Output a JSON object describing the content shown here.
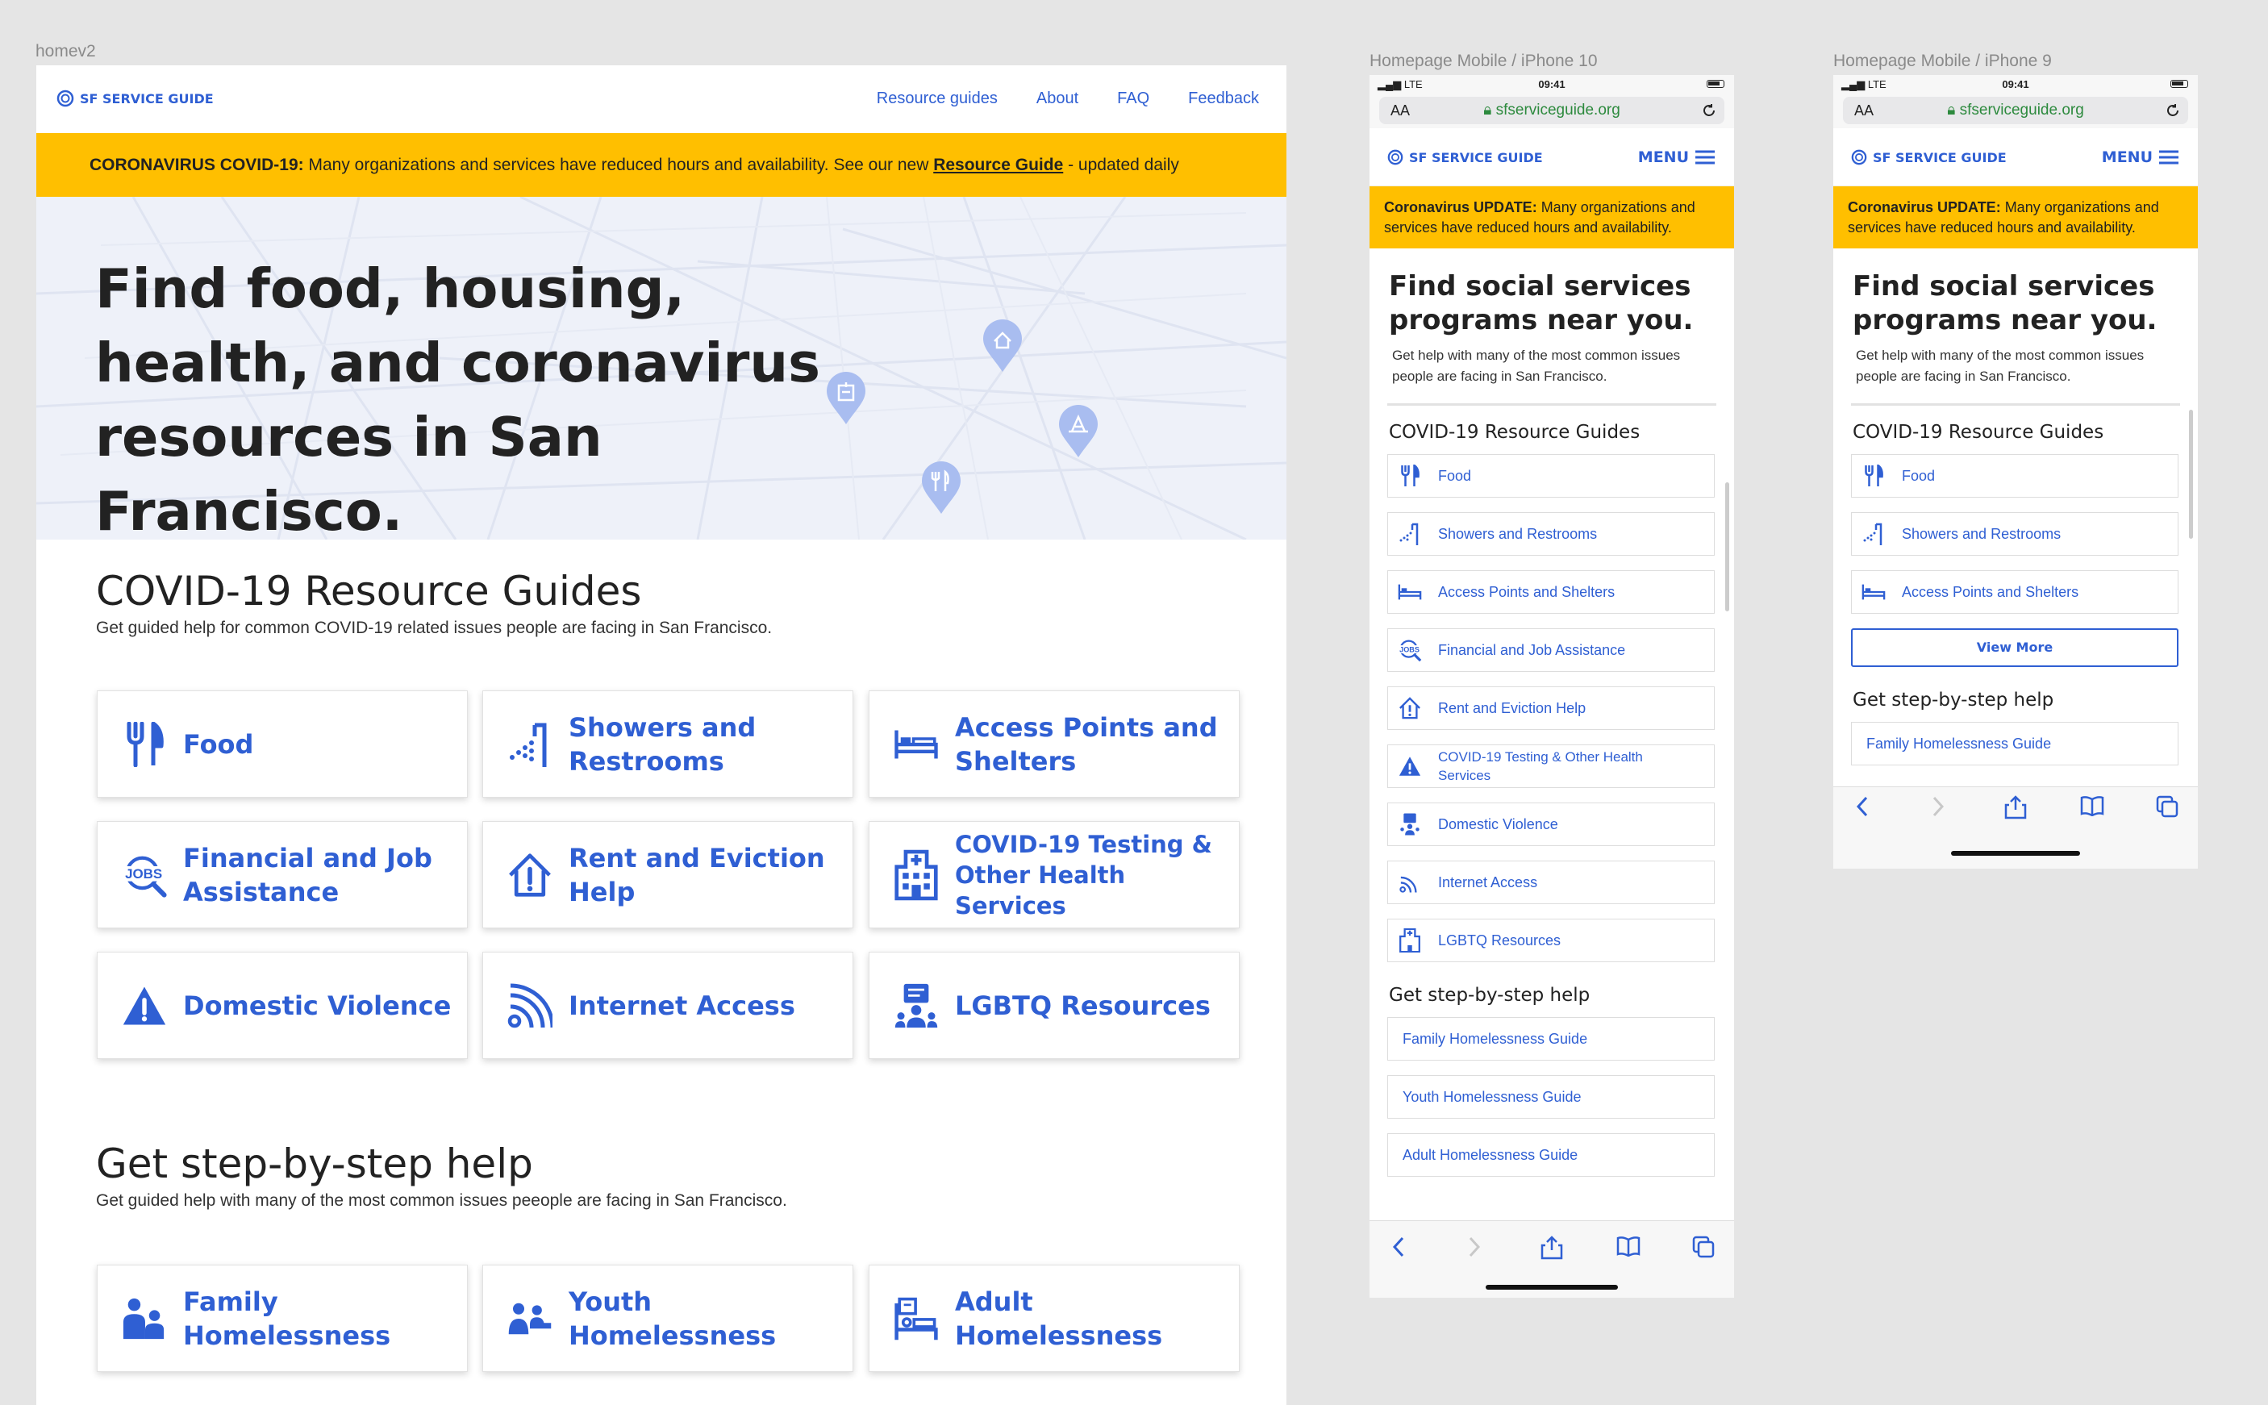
{
  "frames": {
    "desktop_label": "homev2",
    "mobile_label_1": "Homepage Mobile / iPhone 10",
    "mobile_label_2": "Homepage Mobile / iPhone 9"
  },
  "brand": {
    "logo_text": "SF SERVICE GUIDE",
    "accent": "#2f5fd3",
    "banner_color": "#ffbf00"
  },
  "desktop": {
    "nav": [
      "Resource guides",
      "About",
      "FAQ",
      "Feedback"
    ],
    "banner": {
      "prefix": "CORONAVIRUS COVID-19:",
      "text": " Many organizations and services have reduced hours and availability. See our new ",
      "link": "Resource Guide",
      "suffix": " - updated daily"
    },
    "hero_title": "Find food, housing, health, and coronavirus resources in San Francisco.",
    "covid_section": {
      "title": "COVID-19 Resource Guides",
      "subtitle": "Get guided help for common COVID-19 related issues people are facing in San Francisco.",
      "cards": [
        {
          "label": "Food",
          "icon": "utensils-icon"
        },
        {
          "label": "Showers and Restrooms",
          "icon": "shower-icon"
        },
        {
          "label": "Access Points and Shelters",
          "icon": "bed-icon"
        },
        {
          "label": "Financial and Job Assistance",
          "icon": "jobs-search-icon"
        },
        {
          "label": "Rent and Eviction Help",
          "icon": "house-alert-icon"
        },
        {
          "label": "COVID-19 Testing & Other Health Services",
          "icon": "hospital-icon"
        },
        {
          "label": "Domestic Violence",
          "icon": "warning-icon"
        },
        {
          "label": "Internet Access",
          "icon": "wifi-icon"
        },
        {
          "label": "LGBTQ Resources",
          "icon": "community-icon"
        }
      ]
    },
    "steps_section": {
      "title": "Get step-by-step help",
      "subtitle": "Get guided help with many of the most common issues peeople are facing in San Francisco.",
      "cards": [
        {
          "label": "Family Homelessness",
          "icon": "family-icon"
        },
        {
          "label": "Youth Homelessness",
          "icon": "youth-icon"
        },
        {
          "label": "Adult Homelessness",
          "icon": "adult-bed-icon"
        }
      ]
    }
  },
  "mobile": {
    "status": {
      "network": "LTE",
      "time": "09:41"
    },
    "url": "sfserviceguide.org",
    "aa": "AA",
    "menu_label": "MENU",
    "banner": {
      "prefix": "Coronavirus UPDATE:",
      "text": " Many organizations and services have reduced hours and availability."
    },
    "hero_title": "Find social services programs near you.",
    "hero_sub": "Get help with many of the most common issues people are facing in San Francisco.",
    "covid_title": "COVID-19 Resource Guides",
    "items": [
      "Food",
      "Showers and Restrooms",
      "Access Points and Shelters",
      "Financial and Job Assistance",
      "Rent and Eviction Help",
      "COVID-19 Testing & Other Health Services",
      "Domestic Violence",
      "Internet Access",
      "LGBTQ Resources"
    ],
    "steps_title": "Get step-by-step help",
    "steps": [
      "Family Homelessness Guide",
      "Youth Homelessness Guide",
      "Adult Homelessness Guide"
    ],
    "view_more": "View More"
  }
}
